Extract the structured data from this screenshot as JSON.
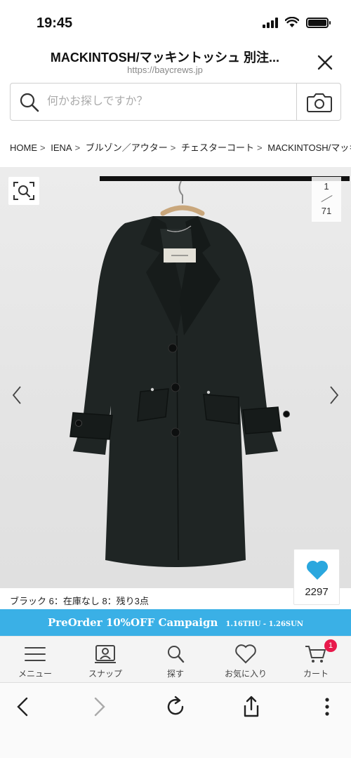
{
  "status_bar": {
    "time": "19:45"
  },
  "browser": {
    "page_title": "MACKINTOSH/マッキントッシュ 別注...",
    "url": "https://baycrews.jp"
  },
  "search": {
    "placeholder": "何かお探しですか？"
  },
  "breadcrumb": {
    "items": [
      "HOME",
      "IENA",
      "ブルゾン／アウター",
      "チェスターコート",
      "MACKINTOSH/マッキ"
    ],
    "separator": ">"
  },
  "gallery": {
    "current": "1",
    "total": "71",
    "like_count": "2297"
  },
  "stock_info": "ブラック 6：在庫なし 8：残り3点",
  "campaign": {
    "main": "PreOrder 10%OFF Campaign",
    "dates": "1.16THU - 1.26SUN"
  },
  "app_nav": {
    "items": [
      {
        "label": "メニュー",
        "icon": "hamburger-icon"
      },
      {
        "label": "スナップ",
        "icon": "snap-icon"
      },
      {
        "label": "探す",
        "icon": "search-icon"
      },
      {
        "label": "お気に入り",
        "icon": "heart-icon"
      },
      {
        "label": "カート",
        "icon": "cart-icon"
      }
    ],
    "cart_badge": "1"
  },
  "colors": {
    "campaign_bg": "#3ab0e6",
    "like_heart": "#2aa7de",
    "badge": "#e8194b"
  }
}
